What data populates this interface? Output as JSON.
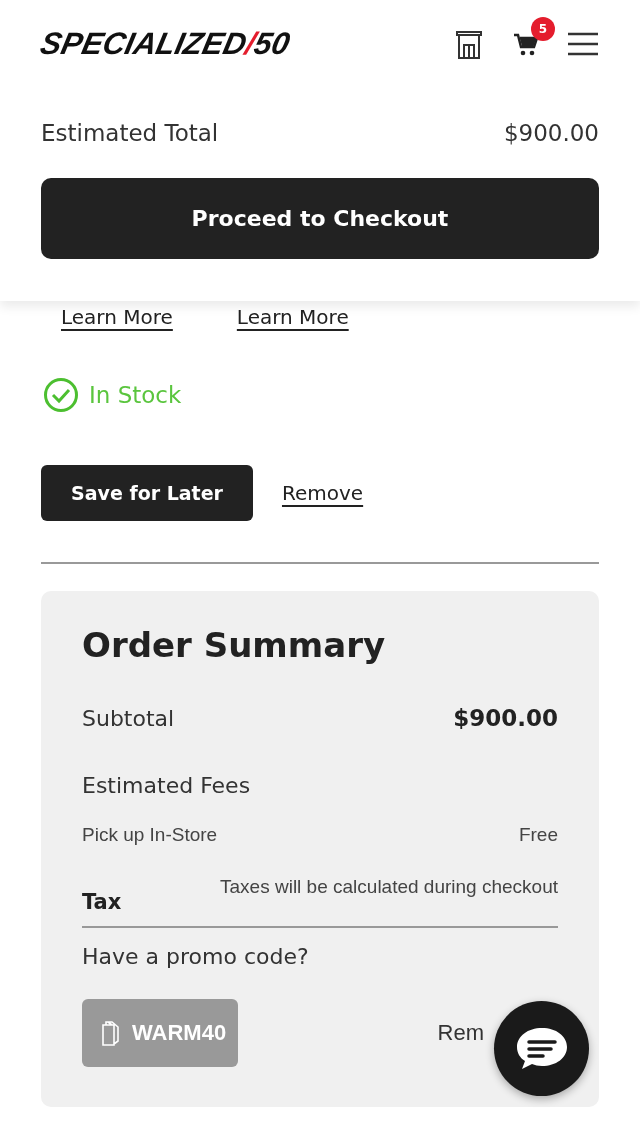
{
  "header": {
    "logo": {
      "name": "SPECIALIZED",
      "slash": "/",
      "suffix": "50"
    },
    "cart_count": "5"
  },
  "sticky_total": {
    "label": "Estimated Total",
    "value": "$900.00",
    "button": "Proceed to Checkout"
  },
  "links": [
    "Learn More",
    "Learn More"
  ],
  "stock": {
    "label": "In Stock",
    "in_stock": true
  },
  "actions": {
    "save": "Save for Later",
    "remove": "Remove"
  },
  "summary": {
    "title": "Order Summary",
    "subtotal_label": "Subtotal",
    "subtotal": "$900.00",
    "fees_title": "Estimated Fees",
    "fees": [
      {
        "label": "Pick up In-Store",
        "value": "Free"
      }
    ],
    "tax_label": "Tax",
    "tax_note": "Taxes will be calculated during checkout",
    "promo_prompt": "Have a promo code?",
    "promo_code": "WARM40",
    "promo_remove": "Rem"
  }
}
